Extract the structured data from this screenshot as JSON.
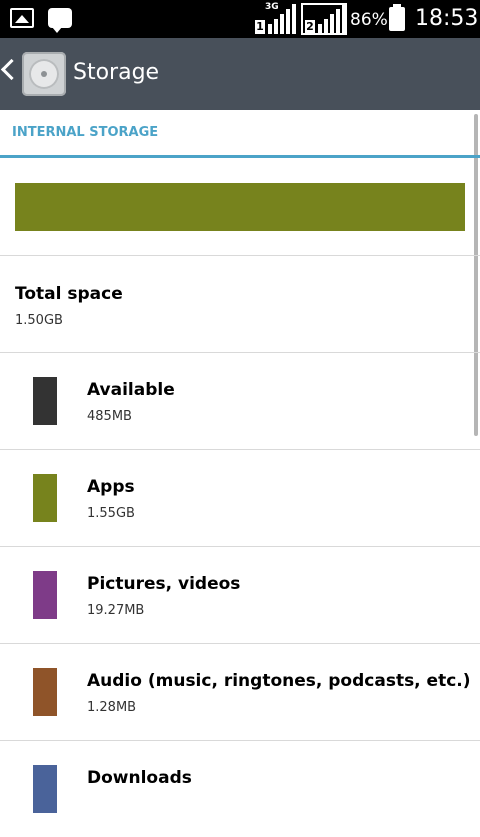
{
  "status_bar": {
    "network_type": "3G",
    "sim1_number": "1",
    "sim2_number": "2",
    "battery": "86%",
    "time": "18:53",
    "icons": [
      "gallery-icon",
      "bbm-icon",
      "signal-icon",
      "battery-icon"
    ]
  },
  "action_bar": {
    "title": "Storage",
    "icon": "storage-icon"
  },
  "section": {
    "title": "INTERNAL STORAGE"
  },
  "usage_bar": {
    "color": "#77831d"
  },
  "total": {
    "label": "Total space",
    "value": "1.50GB"
  },
  "categories": [
    {
      "label": "Available",
      "value": "485MB",
      "color": "#333333"
    },
    {
      "label": "Apps",
      "value": "1.55GB",
      "color": "#77831d"
    },
    {
      "label": "Pictures, videos",
      "value": "19.27MB",
      "color": "#7e3b88"
    },
    {
      "label": "Audio (music, ringtones, podcasts, etc.)",
      "value": "1.28MB",
      "color": "#8f5429"
    },
    {
      "label": "Downloads",
      "value": "",
      "color": "#4a639a"
    }
  ]
}
